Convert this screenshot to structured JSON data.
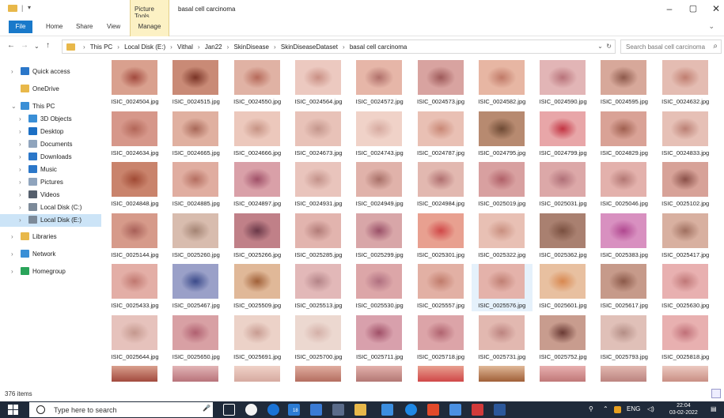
{
  "window": {
    "picture_tools_label": "Picture Tools",
    "title": "basal cell carcinoma",
    "minimize": "–",
    "maximize": "▢",
    "close": "✕"
  },
  "ribbon": {
    "tabs": [
      "File",
      "Home",
      "Share",
      "View",
      "Manage"
    ]
  },
  "address": {
    "crumbs": [
      "This PC",
      "Local Disk (E:)",
      "Vithal",
      "Jan22",
      "SkinDisease",
      "SkinDiseaseDataset",
      "basal cell carcinoma"
    ],
    "search_placeholder": "Search basal cell carcinoma"
  },
  "nav": [
    {
      "label": "Quick access",
      "icon": "star-icon",
      "color": "#2b77c9"
    },
    {
      "label": "OneDrive",
      "icon": "folder-icon",
      "color": "#e8b84a"
    },
    {
      "label": "This PC",
      "icon": "monitor-icon",
      "color": "#3a8fd6"
    },
    {
      "label": "3D Objects",
      "icon": "cube-icon",
      "color": "#3a8fd6"
    },
    {
      "label": "Desktop",
      "icon": "desktop-icon",
      "color": "#1c6fc4"
    },
    {
      "label": "Documents",
      "icon": "document-icon",
      "color": "#8fa4bd"
    },
    {
      "label": "Downloads",
      "icon": "download-icon",
      "color": "#2b77c9"
    },
    {
      "label": "Music",
      "icon": "music-icon",
      "color": "#2b77c9"
    },
    {
      "label": "Pictures",
      "icon": "pictures-icon",
      "color": "#8fa4bd"
    },
    {
      "label": "Videos",
      "icon": "videos-icon",
      "color": "#555f6d"
    },
    {
      "label": "Local Disk (C:)",
      "icon": "drive-icon",
      "color": "#7c8a99"
    },
    {
      "label": "Local Disk (E:)",
      "icon": "drive-icon",
      "color": "#7c8a99"
    },
    {
      "label": "Libraries",
      "icon": "library-icon",
      "color": "#e8b84a"
    },
    {
      "label": "Network",
      "icon": "network-icon",
      "color": "#3a8fd6"
    },
    {
      "label": "Homegroup",
      "icon": "homegroup-icon",
      "color": "#2aa45a"
    }
  ],
  "files": [
    "ISIC_0024504.jpg",
    "ISIC_0024515.jpg",
    "ISIC_0024550.jpg",
    "ISIC_0024564.jpg",
    "ISIC_0024572.jpg",
    "ISIC_0024573.jpg",
    "ISIC_0024582.jpg",
    "ISIC_0024590.jpg",
    "ISIC_0024595.jpg",
    "ISIC_0024632.jpg",
    "ISIC_0024634.jpg",
    "ISIC_0024665.jpg",
    "ISIC_0024666.jpg",
    "ISIC_0024673.jpg",
    "ISIC_0024743.jpg",
    "ISIC_0024787.jpg",
    "ISIC_0024795.jpg",
    "ISIC_0024799.jpg",
    "ISIC_0024829.jpg",
    "ISIC_0024833.jpg",
    "ISIC_0024848.jpg",
    "ISIC_0024885.jpg",
    "ISIC_0024897.jpg",
    "ISIC_0024931.jpg",
    "ISIC_0024949.jpg",
    "ISIC_0024984.jpg",
    "ISIC_0025019.jpg",
    "ISIC_0025031.jpg",
    "ISIC_0025046.jpg",
    "ISIC_0025102.jpg",
    "ISIC_0025144.jpg",
    "ISIC_0025260.jpg",
    "ISIC_0025266.jpg",
    "ISIC_0025285.jpg",
    "ISIC_0025299.jpg",
    "ISIC_0025301.jpg",
    "ISIC_0025322.jpg",
    "ISIC_0025362.jpg",
    "ISIC_0025383.jpg",
    "ISIC_0025417.jpg",
    "ISIC_0025433.jpg",
    "ISIC_0025467.jpg",
    "ISIC_0025509.jpg",
    "ISIC_0025513.jpg",
    "ISIC_0025530.jpg",
    "ISIC_0025557.jpg",
    "ISIC_0025576.jpg",
    "ISIC_0025601.jpg",
    "ISIC_0025617.jpg",
    "ISIC_0025630.jpg",
    "ISIC_0025644.jpg",
    "ISIC_0025650.jpg",
    "ISIC_0025691.jpg",
    "ISIC_0025700.jpg",
    "ISIC_0025711.jpg",
    "ISIC_0025718.jpg",
    "ISIC_0025731.jpg",
    "ISIC_0025752.jpg",
    "ISIC_0025793.jpg",
    "ISIC_0025818.jpg"
  ],
  "thumb_colors": [
    [
      "#d9a08e",
      "#a24a3e"
    ],
    [
      "#c98a76",
      "#7a3426"
    ],
    [
      "#e0b2a4",
      "#b66a5a"
    ],
    [
      "#ecc9c0",
      "#c98f84"
    ],
    [
      "#e6b6a8",
      "#b0706a"
    ],
    [
      "#d8a3a0",
      "#9e5a5a"
    ],
    [
      "#e7b6a3",
      "#c07a68"
    ],
    [
      "#e2b5b6",
      "#b8737a"
    ],
    [
      "#d7a89a",
      "#8e5a4c"
    ],
    [
      "#e4bcb2",
      "#c07e70"
    ],
    [
      "#d6978a",
      "#b26658"
    ],
    [
      "#e0b0a0",
      "#a86858"
    ],
    [
      "#ecc8bc",
      "#c69384"
    ],
    [
      "#e8c2b8",
      "#c4968c"
    ],
    [
      "#f0d2c8",
      "#d6aaa0"
    ],
    [
      "#e9c0b4",
      "#c98876"
    ],
    [
      "#b78a70",
      "#6e4a34"
    ],
    [
      "#e8a6a8",
      "#c23442"
    ],
    [
      "#d9a296",
      "#a06050"
    ],
    [
      "#e6c0b6",
      "#bb8074"
    ],
    [
      "#c9836c",
      "#a04a34"
    ],
    [
      "#e0ada0",
      "#b46e60"
    ],
    [
      "#d9a0a8",
      "#a05068"
    ],
    [
      "#e9c4bc",
      "#c3928a"
    ],
    [
      "#e0b2aa",
      "#a87068"
    ],
    [
      "#e2b8b0",
      "#b07070"
    ],
    [
      "#d8a0a0",
      "#b06068"
    ],
    [
      "#dca8a8",
      "#b07078"
    ],
    [
      "#e3b1ac",
      "#b37874"
    ],
    [
      "#d7a298",
      "#8a5048"
    ],
    [
      "#d69a8a",
      "#a86058"
    ],
    [
      "#d8bcae",
      "#a48474"
    ],
    [
      "#c08088",
      "#6a3848"
    ],
    [
      "#e2b4ae",
      "#b27c78"
    ],
    [
      "#d8a6a8",
      "#9a5068"
    ],
    [
      "#e8a090",
      "#d04848"
    ],
    [
      "#e8c0b4",
      "#c99080"
    ],
    [
      "#a98070",
      "#7a5040"
    ],
    [
      "#d890c0",
      "#b04890"
    ],
    [
      "#d8b0a0",
      "#a07060"
    ],
    [
      "#e3aea6",
      "#c07870"
    ],
    [
      "#9aa0c8",
      "#3b4a8a"
    ],
    [
      "#e0b898",
      "#a06038"
    ],
    [
      "#e2b8b8",
      "#b48488"
    ],
    [
      "#dca6a8",
      "#b07080"
    ],
    [
      "#e2b0a4",
      "#c07c6c"
    ],
    [
      "#e4b2aa",
      "#c08074"
    ],
    [
      "#e8c0a0",
      "#d88850"
    ],
    [
      "#c69a8a",
      "#8c5a4a"
    ],
    [
      "#e8b0b0",
      "#c07878"
    ],
    [
      "#e6c2bc",
      "#c4988e"
    ],
    [
      "#d8a0a4",
      "#b06070"
    ],
    [
      "#ecd2c8",
      "#c89c92"
    ],
    [
      "#ecd8d0",
      "#d4b0a8"
    ],
    [
      "#d8a0ac",
      "#a05068"
    ],
    [
      "#dca4a8",
      "#b06470"
    ],
    [
      "#e2b8b0",
      "#bc8480"
    ],
    [
      "#c89c8e",
      "#6a3a34"
    ],
    [
      "#e0c0b8",
      "#b48e86"
    ],
    [
      "#e8b0b0",
      "#c07078"
    ]
  ],
  "status": {
    "item_count": "376 items"
  },
  "taskbar": {
    "search_placeholder": "Type here to search",
    "badge": "18",
    "time": "22:04",
    "date": "03-02-2022",
    "lang": "ENG"
  }
}
